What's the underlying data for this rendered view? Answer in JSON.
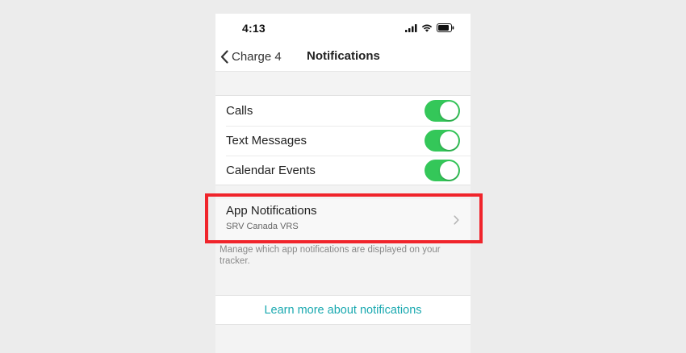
{
  "status_bar": {
    "time": "4:13",
    "icons": [
      "cellular-signal-icon",
      "wifi-icon",
      "battery-icon"
    ]
  },
  "nav": {
    "back_label": "Charge 4",
    "title": "Notifications"
  },
  "toggles": [
    {
      "label": "Calls",
      "on": true
    },
    {
      "label": "Text Messages",
      "on": true
    },
    {
      "label": "Calendar Events",
      "on": true
    }
  ],
  "app_notifications": {
    "title": "App Notifications",
    "subtitle": "SRV Canada VRS"
  },
  "footnote": "Manage which app notifications are displayed on your tracker.",
  "learn_more": "Learn more about notifications",
  "colors": {
    "toggle_on": "#34c759",
    "link": "#1aa9b0",
    "highlight": "#f0242b"
  }
}
